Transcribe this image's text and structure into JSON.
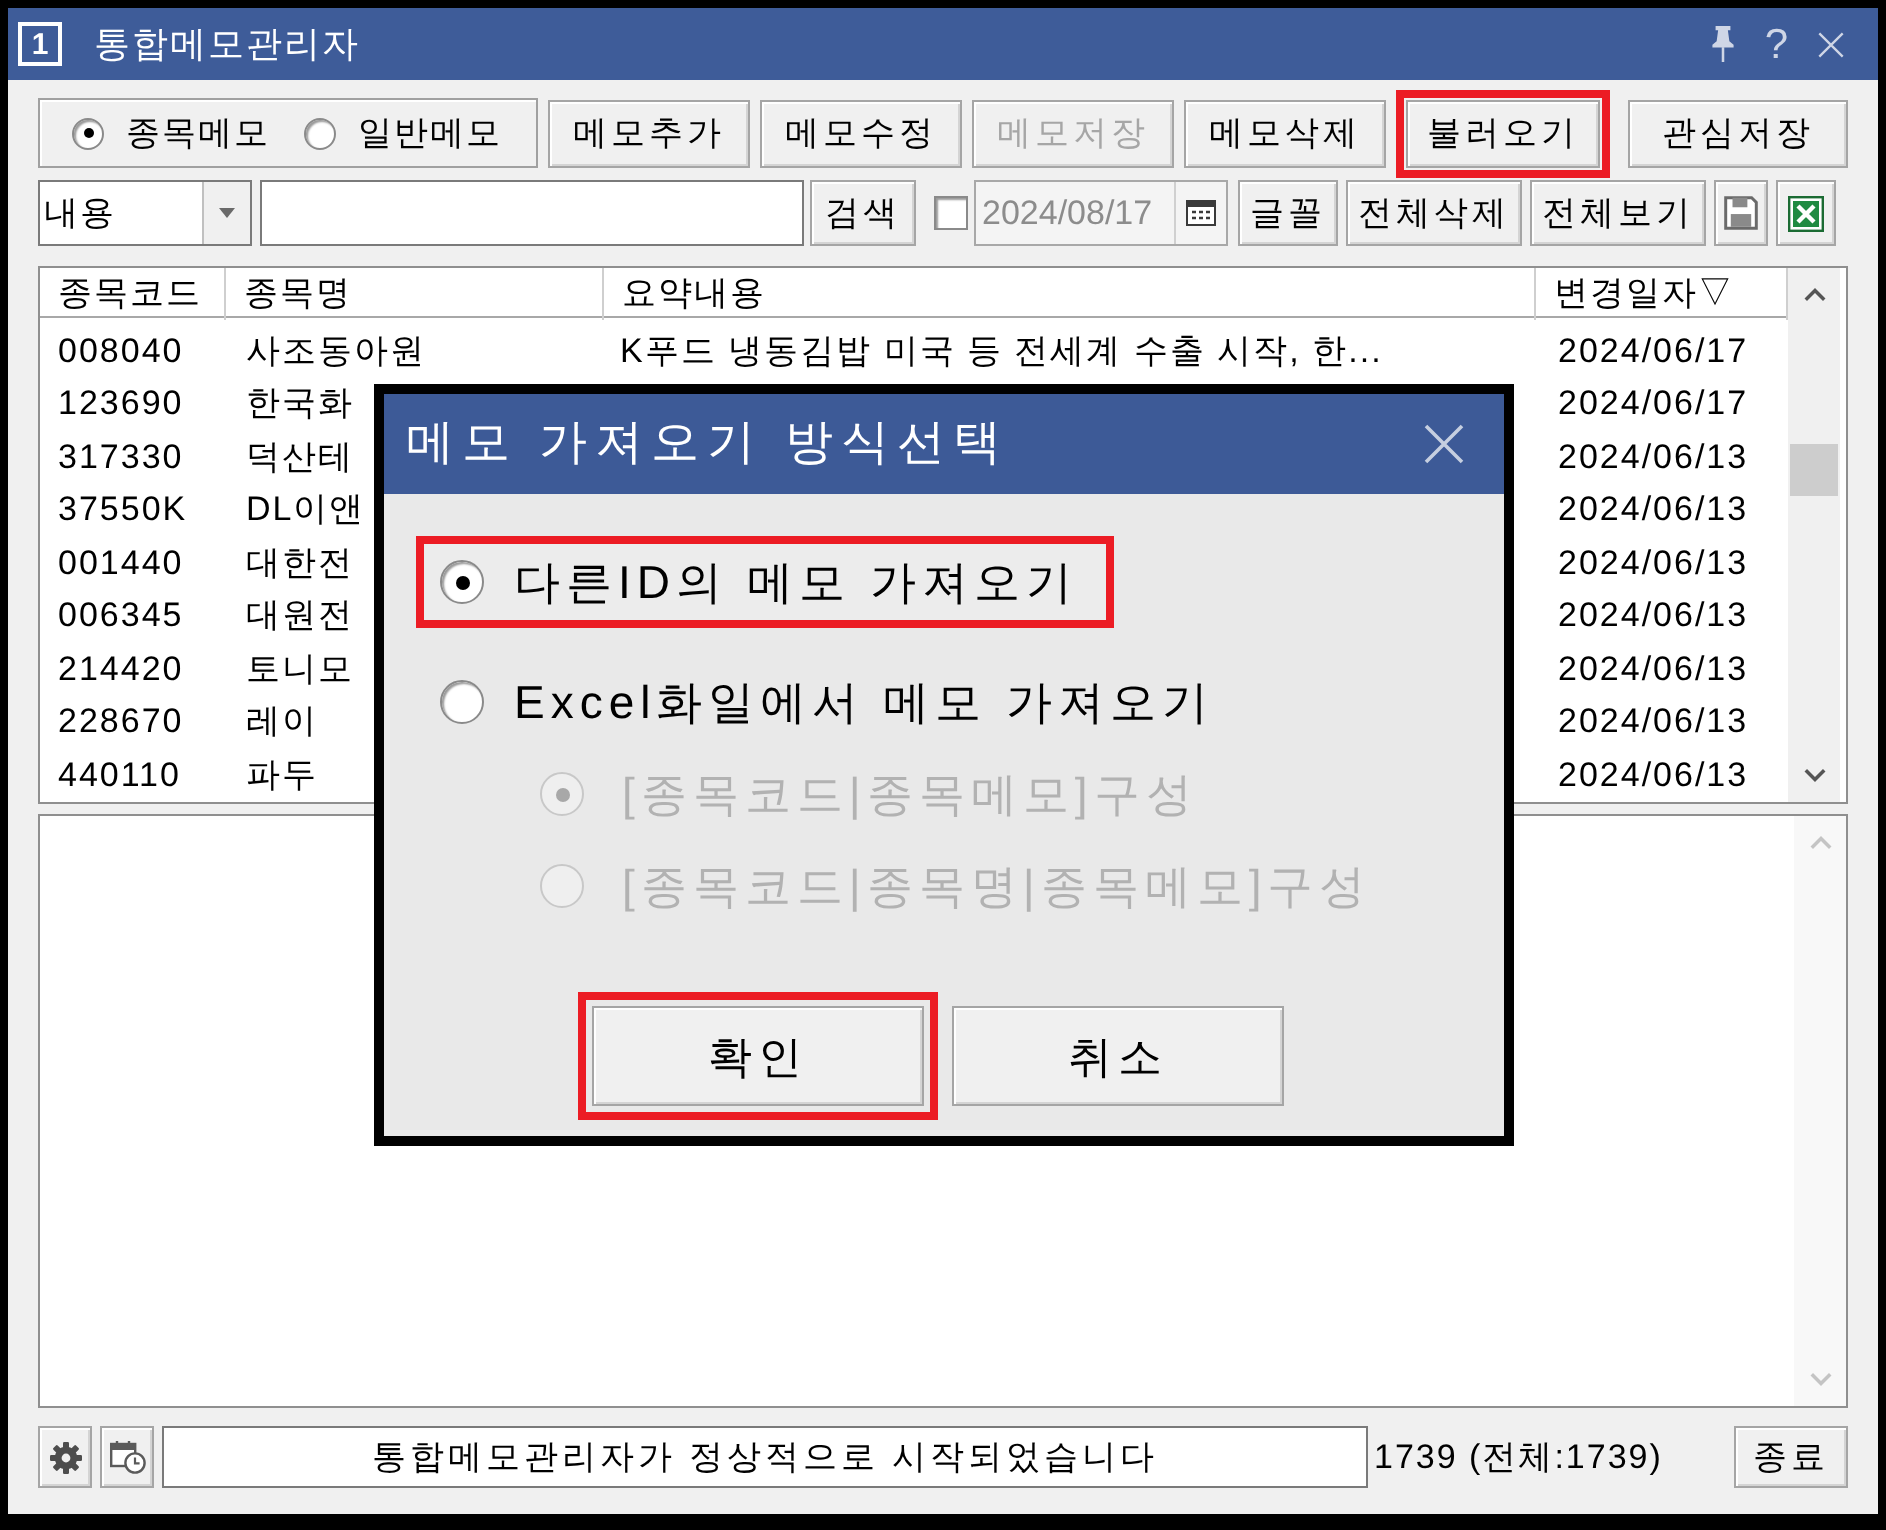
{
  "window": {
    "badge": "1",
    "title": "통합메모관리자",
    "help": "?"
  },
  "memo_type": [
    {
      "label": "종목메모",
      "selected": true
    },
    {
      "label": "일반메모",
      "selected": false
    }
  ],
  "toolbar": [
    {
      "label": "메모추가",
      "disabled": false,
      "highlighted": false
    },
    {
      "label": "메모수정",
      "disabled": false,
      "highlighted": false
    },
    {
      "label": "메모저장",
      "disabled": true,
      "highlighted": false
    },
    {
      "label": "메모삭제",
      "disabled": false,
      "highlighted": false
    },
    {
      "label": "불러오기",
      "disabled": false,
      "highlighted": true
    },
    {
      "label": "관심저장",
      "disabled": false,
      "highlighted": false
    }
  ],
  "search_bar": {
    "scope": "내용",
    "search_button": "검색",
    "date_filter": {
      "checked": false,
      "disabled": true,
      "value": "2024/08/17"
    },
    "actions": [
      {
        "kind": "text",
        "label": "글꼴"
      },
      {
        "kind": "text",
        "label": "전체삭제"
      },
      {
        "kind": "text",
        "label": "전체보기"
      },
      {
        "kind": "save"
      },
      {
        "kind": "excel"
      }
    ]
  },
  "table": {
    "columns": [
      "종목코드",
      "종목명",
      "요약내용",
      "변경일자▽"
    ],
    "rows": [
      {
        "code": "008040",
        "name": "사조동아원",
        "summary": "K푸드 냉동김밥 미국 등 전세계 수출 시작, 한...",
        "date": "2024/06/17"
      },
      {
        "code": "123690",
        "name": "한국화",
        "date": "2024/06/17"
      },
      {
        "code": "317330",
        "name": "덕산테",
        "date": "2024/06/13"
      },
      {
        "code": "37550K",
        "name": "DL이앤",
        "date": "2024/06/13"
      },
      {
        "code": "001440",
        "name": "대한전",
        "date": "2024/06/13"
      },
      {
        "code": "006345",
        "name": "대원전",
        "date": "2024/06/13"
      },
      {
        "code": "214420",
        "name": "토니모",
        "date": "2024/06/13"
      },
      {
        "code": "228670",
        "name": "레이",
        "date": "2024/06/13"
      },
      {
        "code": "440110",
        "name": "파두",
        "date": "2024/06/13"
      }
    ]
  },
  "status_bar": {
    "message": "통합메모관리자가 정상적으로 시작되었습니다",
    "count": "1739 (전체:1739)",
    "exit_button": "종료"
  },
  "dialog": {
    "title": "메모 가져오기 방식선택",
    "options": [
      {
        "label": "다른ID의 메모 가져오기",
        "selected": true,
        "highlighted": true
      },
      {
        "label": "Excel화일에서 메모 가져오기",
        "selected": false,
        "highlighted": false,
        "sub_options": [
          {
            "label": "[종목코드|종목메모]구성",
            "selected": true,
            "disabled": true
          },
          {
            "label": "[종목코드|종목명|종목메모]구성",
            "selected": false,
            "disabled": true
          }
        ]
      }
    ],
    "buttons": [
      {
        "label": "확인",
        "highlighted": true
      },
      {
        "label": "취소",
        "highlighted": false
      }
    ]
  }
}
